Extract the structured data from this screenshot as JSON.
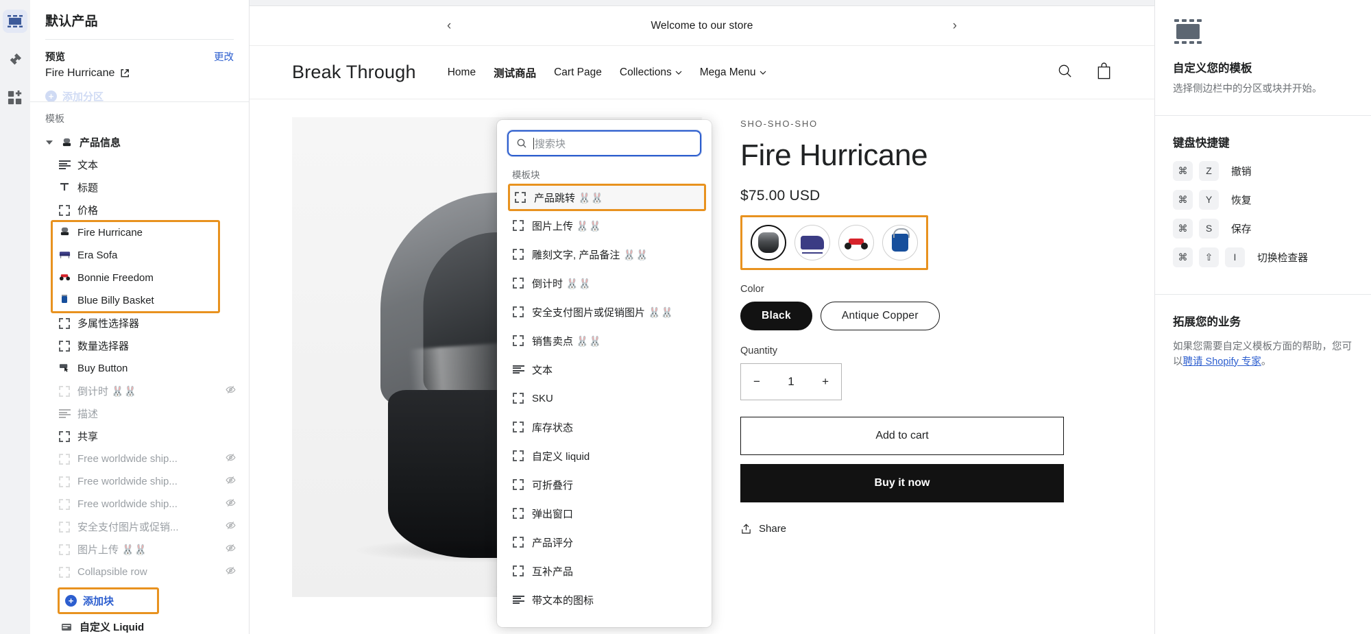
{
  "rail": {
    "items": [
      {
        "name": "sections-icon",
        "active": true
      },
      {
        "name": "theme-settings-icon",
        "active": false
      },
      {
        "name": "apps-icon",
        "active": false
      }
    ]
  },
  "sidebar": {
    "title": "默认产品",
    "preview_label": "预览",
    "change_label": "更改",
    "preview_name": "Fire Hurricane",
    "faded_add_section": "添加分区",
    "tree_heading": "模板",
    "root": {
      "label": "产品信息",
      "icon": "lamp-thumb"
    },
    "items": [
      {
        "label": "文本",
        "icon": "text-icon",
        "dim": false,
        "hidden": false,
        "indent": 1
      },
      {
        "label": "标题",
        "icon": "title-icon",
        "dim": false,
        "hidden": false,
        "indent": 1
      },
      {
        "label": "价格",
        "icon": "block-icon",
        "dim": false,
        "hidden": false,
        "indent": 1
      },
      {
        "label": "Fire Hurricane",
        "icon": "lamp-thumb",
        "dim": false,
        "hidden": false,
        "indent": 1,
        "highlight": "start"
      },
      {
        "label": "Era Sofa",
        "icon": "sofa-thumb",
        "dim": false,
        "hidden": false,
        "indent": 1,
        "highlight": "mid"
      },
      {
        "label": "Bonnie Freedom",
        "icon": "car-thumb",
        "dim": false,
        "hidden": false,
        "indent": 1,
        "highlight": "mid"
      },
      {
        "label": "Blue Billy Basket",
        "icon": "bucket-thumb",
        "dim": false,
        "hidden": false,
        "indent": 1,
        "highlight": "end"
      },
      {
        "label": "多属性选择器",
        "icon": "block-icon",
        "dim": false,
        "hidden": false,
        "indent": 1
      },
      {
        "label": "数量选择器",
        "icon": "block-icon",
        "dim": false,
        "hidden": false,
        "indent": 1
      },
      {
        "label": "Buy Button",
        "icon": "cursor-thumb",
        "dim": false,
        "hidden": false,
        "indent": 1
      },
      {
        "label": "倒计时 🐰🐰",
        "icon": "block-icon",
        "dim": true,
        "hidden": true,
        "indent": 1
      },
      {
        "label": "描述",
        "icon": "text-icon",
        "dim": true,
        "hidden": false,
        "indent": 1
      },
      {
        "label": "共享",
        "icon": "block-icon",
        "dim": false,
        "hidden": false,
        "indent": 1
      },
      {
        "label": "Free worldwide ship...",
        "icon": "block-icon",
        "dim": true,
        "hidden": true,
        "indent": 1
      },
      {
        "label": "Free worldwide ship...",
        "icon": "block-icon",
        "dim": true,
        "hidden": true,
        "indent": 1
      },
      {
        "label": "Free worldwide ship...",
        "icon": "block-icon",
        "dim": true,
        "hidden": true,
        "indent": 1
      },
      {
        "label": "安全支付图片或促销...",
        "icon": "block-icon",
        "dim": true,
        "hidden": true,
        "indent": 1
      },
      {
        "label": "图片上传 🐰🐰",
        "icon": "block-icon",
        "dim": true,
        "hidden": true,
        "indent": 1
      },
      {
        "label": "Collapsible row",
        "icon": "block-icon",
        "dim": true,
        "hidden": true,
        "indent": 1
      }
    ],
    "add_block_label": "添加块",
    "footer_item": {
      "label": "自定义 Liquid",
      "icon": "liquid-icon"
    }
  },
  "picker": {
    "search_placeholder": "搜索块",
    "search_value": "",
    "group_label": "模板块",
    "items": [
      {
        "label": "产品跳转 🐰🐰",
        "icon": "block-icon",
        "selected": true
      },
      {
        "label": "图片上传 🐰🐰",
        "icon": "block-icon",
        "selected": false
      },
      {
        "label": "雕刻文字, 产品备注 🐰🐰",
        "icon": "block-icon",
        "selected": false
      },
      {
        "label": "倒计时 🐰🐰",
        "icon": "block-icon",
        "selected": false
      },
      {
        "label": "安全支付图片或促销图片 🐰🐰",
        "icon": "block-icon",
        "selected": false
      },
      {
        "label": "销售卖点 🐰🐰",
        "icon": "block-icon",
        "selected": false
      },
      {
        "label": "文本",
        "icon": "text-icon",
        "selected": false
      },
      {
        "label": "SKU",
        "icon": "block-icon",
        "selected": false
      },
      {
        "label": "库存状态",
        "icon": "block-icon",
        "selected": false
      },
      {
        "label": "自定义 liquid",
        "icon": "block-icon",
        "selected": false
      },
      {
        "label": "可折叠行",
        "icon": "block-icon",
        "selected": false
      },
      {
        "label": "弹出窗口",
        "icon": "block-icon",
        "selected": false
      },
      {
        "label": "产品评分",
        "icon": "block-icon",
        "selected": false
      },
      {
        "label": "互补产品",
        "icon": "block-icon",
        "selected": false
      },
      {
        "label": "带文本的图标",
        "icon": "text-icon",
        "selected": false
      }
    ]
  },
  "preview": {
    "announcement": "Welcome to our store",
    "brand": "Break Through",
    "nav": [
      {
        "label": "Home",
        "active": false,
        "dropdown": false
      },
      {
        "label": "测试商品",
        "active": true,
        "dropdown": false
      },
      {
        "label": "Cart Page",
        "active": false,
        "dropdown": false
      },
      {
        "label": "Collections",
        "active": false,
        "dropdown": true
      },
      {
        "label": "Mega Menu",
        "active": false,
        "dropdown": true
      }
    ],
    "product": {
      "vendor": "SHO-SHO-SHO",
      "title": "Fire Hurricane",
      "price": "$75.00 USD",
      "swatches": [
        {
          "name": "fire-hurricane-swatch",
          "selected": true
        },
        {
          "name": "era-sofa-swatch",
          "selected": false
        },
        {
          "name": "bonnie-freedom-swatch",
          "selected": false
        },
        {
          "name": "blue-billy-basket-swatch",
          "selected": false
        }
      ],
      "color_label": "Color",
      "color_options": [
        {
          "label": "Black",
          "selected": true
        },
        {
          "label": "Antique Copper",
          "selected": false
        }
      ],
      "quantity_label": "Quantity",
      "quantity_value": "1",
      "minus": "−",
      "plus": "+",
      "add_to_cart": "Add to cart",
      "buy_now": "Buy it now",
      "share": "Share"
    }
  },
  "rightbar": {
    "customize_title": "自定义您的模板",
    "customize_sub": "选择侧边栏中的分区或块并开始。",
    "shortcuts_title": "键盘快捷键",
    "shortcuts": [
      {
        "keys": [
          "⌘",
          "Z"
        ],
        "label": "撤销"
      },
      {
        "keys": [
          "⌘",
          "Y"
        ],
        "label": "恢复"
      },
      {
        "keys": [
          "⌘",
          "S"
        ],
        "label": "保存"
      },
      {
        "keys": [
          "⌘",
          "⇧",
          "I"
        ],
        "label": "切换检查器"
      }
    ],
    "grow_title": "拓展您的业务",
    "grow_text_1": "如果您需要自定义模板方面的帮助，您可以",
    "grow_link": "聘请 Shopify 专家",
    "grow_text_2": "。"
  },
  "colors": {
    "accent_orange": "#e8921f",
    "link_blue": "#2c5ecf",
    "dark": "#121212"
  }
}
